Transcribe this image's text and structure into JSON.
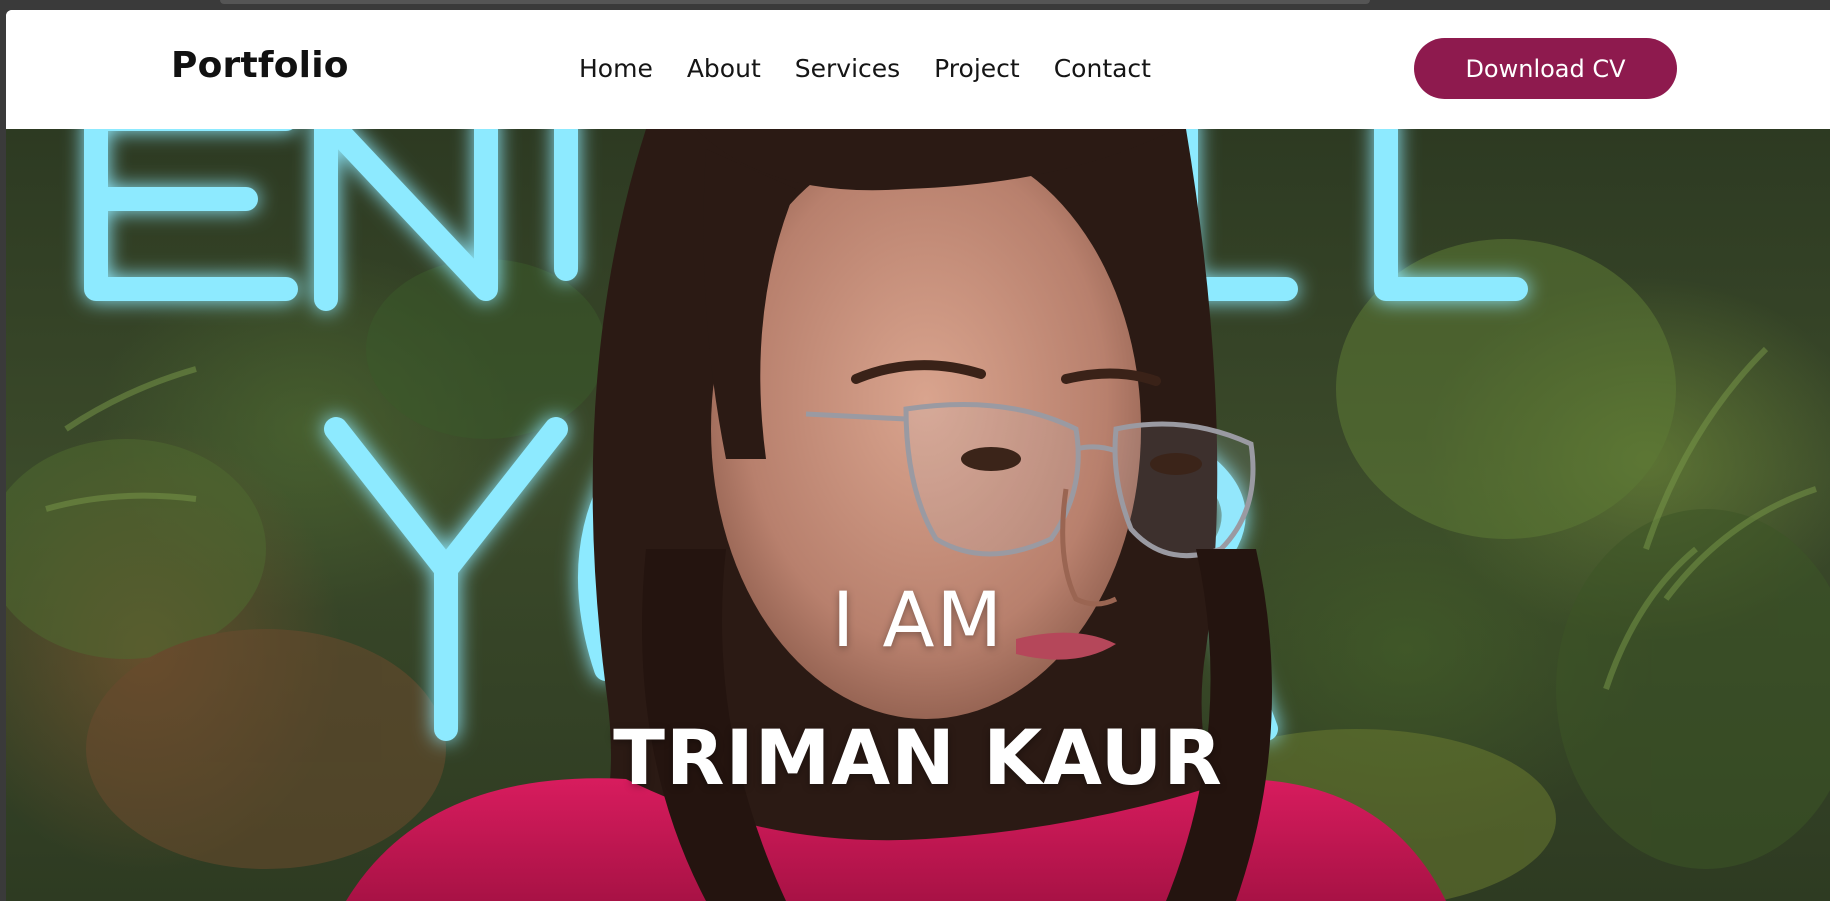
{
  "navbar": {
    "brand": "Portfolio",
    "links": [
      "Home",
      "About",
      "Services",
      "Project",
      "Contact"
    ],
    "cta_label": "Download CV"
  },
  "hero": {
    "intro": "I AM",
    "name": "TRIMAN KAUR",
    "background_description_colors": {
      "neon": "#7fe3ff",
      "foliage": "#3b4a2a",
      "shirt": "#d0185a"
    }
  },
  "colors": {
    "accent": "#8e1a4e",
    "nav_bg": "#ffffff",
    "text_dark": "#151515"
  }
}
